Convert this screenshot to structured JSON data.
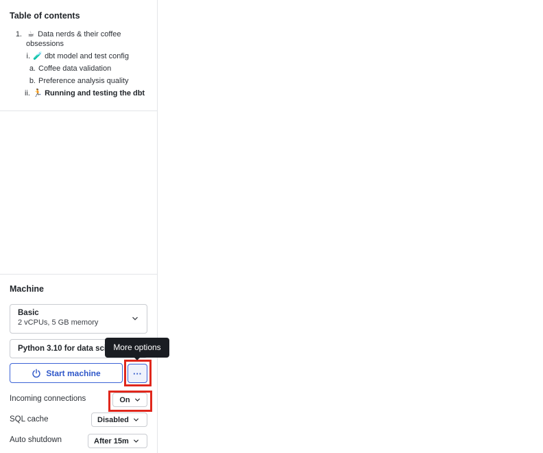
{
  "toc": {
    "title": "Table of contents",
    "items": [
      {
        "num": "1.",
        "emoji": "☕",
        "label": "Data nerds & their coffee obsessions",
        "line2": "obsessions"
      },
      {
        "num": "i.",
        "emoji": "🧪",
        "label": "dbt model and test config"
      },
      {
        "num": "a.",
        "label": "Coffee data validation"
      },
      {
        "num": "b.",
        "label": "Preference analysis quality"
      },
      {
        "num": "ii.",
        "emoji": "🏃",
        "label": "Running and testing the dbt"
      }
    ]
  },
  "machine": {
    "title": "Machine",
    "selected_name": "Basic",
    "selected_specs": "2 vCPUs, 5 GB memory",
    "environment": "Python 3.10 for data science",
    "start_label": "Start machine",
    "more_label": "···",
    "tooltip": "More options",
    "settings": {
      "incoming_label": "Incoming connections",
      "incoming_value": "On",
      "sql_cache_label": "SQL cache",
      "sql_cache_value": "Disabled",
      "auto_shutdown_label": "Auto shutdown",
      "auto_shutdown_value": "After 15m"
    }
  },
  "colors": {
    "accent": "#2f57c9",
    "highlight": "#e0271c",
    "tooltip_bg": "#1a1d22"
  }
}
